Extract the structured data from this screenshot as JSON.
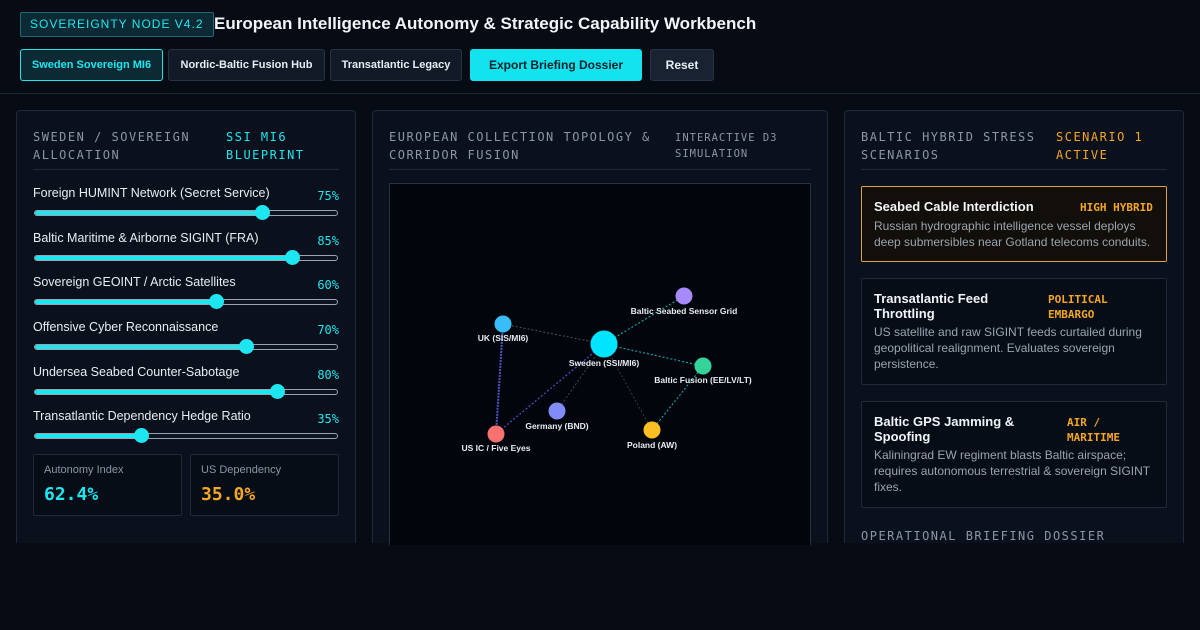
{
  "header": {
    "badge": "SOVEREIGNTY NODE V4.2",
    "title": "European Intelligence Autonomy & Strategic Capability Workbench",
    "tabs": [
      {
        "label": "Sweden Sovereign MI6",
        "active": true
      },
      {
        "label": "Nordic-Baltic Fusion Hub",
        "active": false
      },
      {
        "label": "Transatlantic Legacy",
        "active": false
      }
    ],
    "export_label": "Export Briefing Dossier",
    "reset_label": "Reset"
  },
  "allocation": {
    "heading": "SWEDEN / SOVEREIGN ALLOCATION",
    "heading_l1": "SWEDEN / SOVEREIGN",
    "heading_l2": "ALLOCATION",
    "tag_l1": "SSI MI6",
    "tag_l2": "BLUEPRINT",
    "sliders": [
      {
        "label": "Foreign HUMINT Network (Secret Service)",
        "value": 75,
        "display": "75%"
      },
      {
        "label": "Baltic Maritime & Airborne SIGINT (FRA)",
        "value": 85,
        "display": "85%"
      },
      {
        "label": "Sovereign GEOINT / Arctic Satellites",
        "value": 60,
        "display": "60%"
      },
      {
        "label": "Offensive Cyber Reconnaissance",
        "value": 70,
        "display": "70%"
      },
      {
        "label": "Undersea Seabed Counter-Sabotage",
        "value": 80,
        "display": "80%"
      },
      {
        "label": "Transatlantic Dependency Hedge Ratio",
        "value": 35,
        "display": "35%"
      }
    ],
    "stats": [
      {
        "label": "Autonomy Index",
        "value": "62.4%",
        "color": "#1ee6f0"
      },
      {
        "label": "US Dependency",
        "value": "35.0%",
        "color": "#f5a623"
      }
    ]
  },
  "topology": {
    "heading_l1": "EUROPEAN COLLECTION TOPOLOGY &",
    "heading_l2": "CORRIDOR FUSION",
    "tag_l1": "INTERACTIVE D3",
    "tag_l2": "SIMULATION",
    "nodes": [
      {
        "id": "sweden",
        "label": "Sweden (SSI/MI6)",
        "color": "#00e5ff"
      },
      {
        "id": "uk",
        "label": "UK (SIS/MI6)",
        "color": "#38bdf8"
      },
      {
        "id": "baltic_grid",
        "label": "Baltic Seabed Sensor Grid",
        "color": "#a78bfa"
      },
      {
        "id": "baltic_fusion",
        "label": "Baltic Fusion (EE/LV/LT)",
        "color": "#34d399"
      },
      {
        "id": "germany",
        "label": "Germany (BND)",
        "color": "#818cf8"
      },
      {
        "id": "poland",
        "label": "Poland (AW)",
        "color": "#fbbf24"
      },
      {
        "id": "us",
        "label": "US IC / Five Eyes",
        "color": "#f87171"
      }
    ]
  },
  "scenarios": {
    "heading": "BALTIC HYBRID STRESS SCENARIOS",
    "heading_l1": "BALTIC HYBRID STRESS",
    "heading_l2": "SCENARIOS",
    "tag_l1": "SCENARIO 1",
    "tag_l2": "ACTIVE",
    "items": [
      {
        "title": "Seabed Cable Interdiction",
        "tag": "HIGH HYBRID",
        "desc": "Russian hydrographic intelligence vessel deploys deep submersibles near Gotland telecoms conduits.",
        "active": true
      },
      {
        "title_l1": "Transatlantic Feed",
        "title_l2": "Throttling",
        "tag_l1": "POLITICAL",
        "tag_l2": "EMBARGO",
        "desc": "US satellite and raw SIGINT feeds curtailed during geopolitical realignment. Evaluates sovereign persistence.",
        "active": false
      },
      {
        "title_l1": "Baltic GPS Jamming &",
        "title_l2": "Spoofing",
        "tag_l1": "AIR /",
        "tag_l2": "MARITIME",
        "desc": "Kaliningrad EW regiment blasts Baltic airspace; requires autonomous terrestrial & sovereign SIGINT fixes.",
        "active": false
      }
    ],
    "dossier_heading": "OPERATIONAL BRIEFING DOSSIER"
  }
}
